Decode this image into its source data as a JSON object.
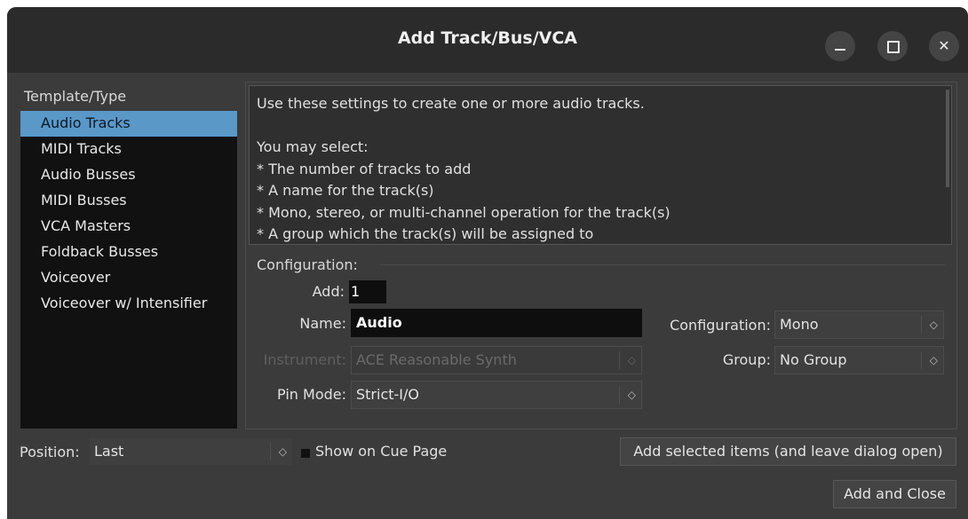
{
  "window": {
    "title": "Add Track/Bus/VCA",
    "controls": {
      "minimize": "minimize-icon",
      "maximize": "maximize-icon",
      "close": "close-icon",
      "close_glyph": "✕"
    }
  },
  "template_type": {
    "label": "Template/Type",
    "items": [
      "Audio Tracks",
      "MIDI Tracks",
      "Audio Busses",
      "MIDI Busses",
      "VCA Masters",
      "Foldback Busses",
      "Voiceover",
      "Voiceover w/ Intensifier"
    ],
    "selected": "Audio Tracks"
  },
  "description": "Use these settings to create one or more audio tracks.\n\nYou may select:\n* The number of tracks to add\n* A name for the track(s)\n* Mono, stereo, or multi-channel operation for the track(s)\n* A group which the track(s) will be assigned to",
  "configuration": {
    "section_label": "Configuration:",
    "add_label": "Add:",
    "add_value": "1",
    "name_label": "Name:",
    "name_value": "Audio",
    "instrument_label": "Instrument:",
    "instrument_value": "ACE Reasonable Synth",
    "pin_mode_label": "Pin Mode:",
    "pin_mode_value": "Strict-I/O",
    "configuration_label": "Configuration:",
    "configuration_value": "Mono",
    "group_label": "Group:",
    "group_value": "No Group"
  },
  "bottom": {
    "position_label": "Position:",
    "position_value": "Last",
    "show_cue_label": "Show on Cue Page",
    "add_selected_button": "Add selected items (and leave dialog open)",
    "add_close_button": "Add and Close"
  },
  "combo_arrow": "◇"
}
